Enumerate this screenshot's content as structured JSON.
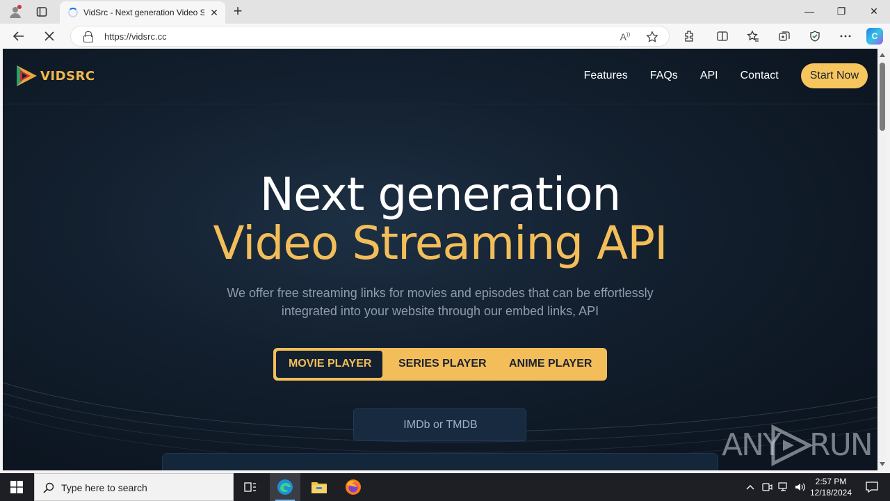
{
  "browser": {
    "tab_title": "VidSrc - Next generation Video St",
    "url": "https://vidsrc.cc",
    "new_tab_label": "+",
    "close_tab_label": "✕",
    "read_aloud_label": "A",
    "copilot_label": "C"
  },
  "window_controls": {
    "minimize": "—",
    "restore": "❐",
    "close": "✕"
  },
  "site": {
    "logo_text": "VIDSRC",
    "nav": [
      "Features",
      "FAQs",
      "API",
      "Contact"
    ],
    "start_button": "Start Now"
  },
  "hero": {
    "line1": "Next generation",
    "line2": "Video Streaming API",
    "description": "We offer free streaming links for movies and episodes that can be effortlessly integrated into your website through our embed links, API"
  },
  "player_tabs": [
    {
      "label": "MOVIE PLAYER",
      "active": true
    },
    {
      "label": "SERIES PLAYER",
      "active": false
    },
    {
      "label": "ANIME PLAYER",
      "active": false
    }
  ],
  "id_input": {
    "placeholder": "IMDb or TMDB"
  },
  "watermark": {
    "text_left": "ANY",
    "text_right": "RUN"
  },
  "taskbar": {
    "search_placeholder": "Type here to search",
    "time": "2:57 PM",
    "date": "12/18/2024"
  },
  "colors": {
    "accent_gold": "#f3be59",
    "page_bg": "#13202f",
    "button_gold": "#f7c55d"
  }
}
